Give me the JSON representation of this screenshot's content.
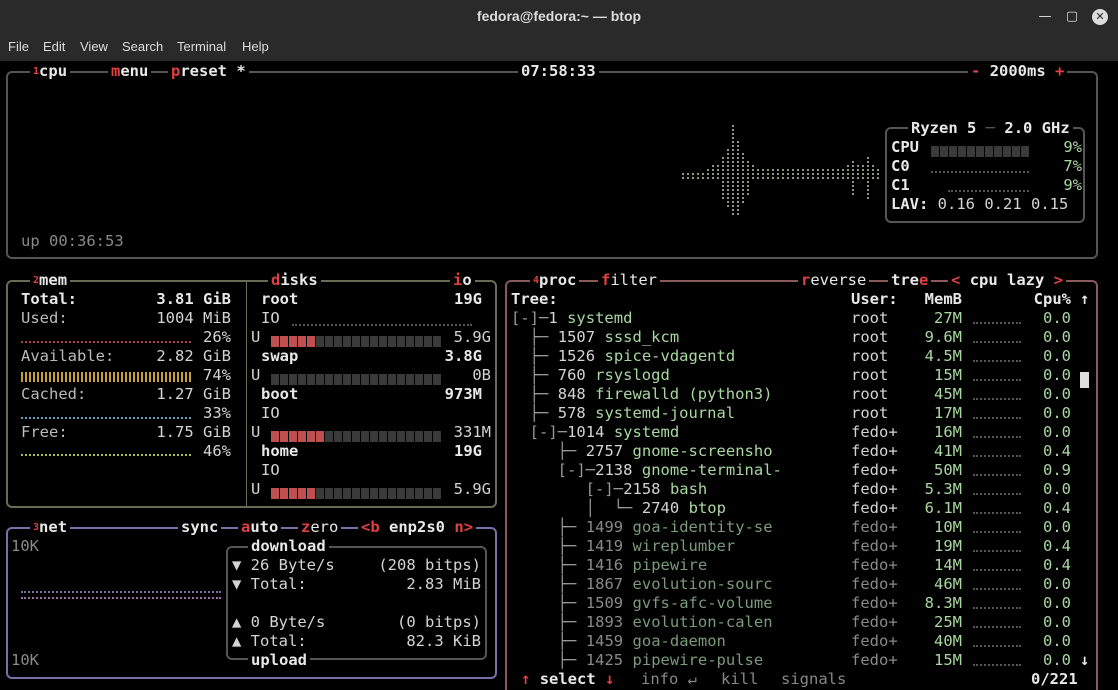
{
  "window": {
    "title": "fedora@fedora:~ — btop"
  },
  "menu": [
    "File",
    "Edit",
    "View",
    "Search",
    "Terminal",
    "Help"
  ],
  "cpu": {
    "num": "1",
    "label": "cpu",
    "menu": "menu",
    "preset": "preset *",
    "clock": "07:58:33",
    "interval": "2000ms",
    "minus": "-",
    "plus": "+",
    "uptime": "up 00:36:53",
    "model": "Ryzen 5",
    "freq": "2.0 GHz",
    "rows": [
      {
        "name": "CPU",
        "val": "9%"
      },
      {
        "name": "C0",
        "val": "7%"
      },
      {
        "name": "C1",
        "val": "9%"
      }
    ],
    "lav_label": "LAV:",
    "lav": "0.16 0.21 0.15"
  },
  "mem": {
    "num": "2",
    "label": "mem",
    "total_label": "Total:",
    "total": "3.81 GiB",
    "rows": [
      {
        "label": "Used:",
        "val": "1004 MiB",
        "pct": "26%",
        "color": "#b04040"
      },
      {
        "label": "Available:",
        "val": "2.82 GiB",
        "pct": "74%",
        "color": "#c8a030"
      },
      {
        "label": "Cached:",
        "val": "1.27 GiB",
        "pct": "33%",
        "color": "#60a0c0"
      },
      {
        "label": "Free:",
        "val": "1.75 GiB",
        "pct": "46%",
        "color": "#a0c040"
      }
    ]
  },
  "disks": {
    "label": "disks",
    "io": "io",
    "items": [
      {
        "name": "root",
        "size": "19G",
        "io": "IO",
        "u": "U",
        "used": "5.9G"
      },
      {
        "name": "swap",
        "size": "3.8G",
        "u": "U",
        "used": "0B"
      },
      {
        "name": "boot",
        "size": "973M",
        "io": "IO",
        "u": "U",
        "used": "331M"
      },
      {
        "name": "home",
        "size": "19G",
        "io": "IO",
        "u": "U",
        "used": "5.9G"
      }
    ]
  },
  "net": {
    "num": "3",
    "label": "net",
    "sync": "sync",
    "auto": "auto",
    "zero": "zero",
    "iface": "<b enp2s0 n>",
    "scale_top": "10K",
    "scale_bottom": "10K",
    "download": "download",
    "upload": "upload",
    "dl_rate": "▼ 26 Byte/s",
    "dl_bits": "(208 bitps)",
    "dl_total_label": "▼ Total:",
    "dl_total": "2.83 MiB",
    "ul_rate": "▲ 0 Byte/s",
    "ul_bits": "(0 bitps)",
    "ul_total_label": "▲ Total:",
    "ul_total": "82.3 KiB"
  },
  "proc": {
    "num": "4",
    "label": "proc",
    "filter": "filter",
    "reverse": "reverse",
    "tree": "tree",
    "lazy": "< cpu lazy >",
    "h_tree": "Tree:",
    "h_user": "User:",
    "h_mem": "MemB",
    "h_cpu": "Cpu%",
    "scroll_up": "↑",
    "scroll_down": "↓",
    "rows": [
      {
        "pre": "[-]─",
        "pid": "1",
        "name": "systemd",
        "user": "root",
        "mem": "27M",
        "cpu": "0.0",
        "dim": false
      },
      {
        "pre": "  ├─ ",
        "pid": "1507",
        "name": "sssd_kcm",
        "user": "root",
        "mem": "9.6M",
        "cpu": "0.0",
        "dim": false
      },
      {
        "pre": "  ├─ ",
        "pid": "1526",
        "name": "spice-vdagentd",
        "user": "root",
        "mem": "4.5M",
        "cpu": "0.0",
        "dim": false
      },
      {
        "pre": "  ├─ ",
        "pid": "760",
        "name": "rsyslogd",
        "user": "root",
        "mem": "15M",
        "cpu": "0.0",
        "dim": false
      },
      {
        "pre": "  ├─ ",
        "pid": "848",
        "name": "firewalld (python3)",
        "user": "root",
        "mem": "45M",
        "cpu": "0.0",
        "dim": false
      },
      {
        "pre": "  ├─ ",
        "pid": "578",
        "name": "systemd-journal",
        "user": "root",
        "mem": "17M",
        "cpu": "0.0",
        "dim": false
      },
      {
        "pre": "  [-]─",
        "pid": "1014",
        "name": "systemd",
        "user": "fedo+",
        "mem": "16M",
        "cpu": "0.0",
        "dim": false
      },
      {
        "pre": "     ├─ ",
        "pid": "2757",
        "name": "gnome-screensho",
        "user": "fedo+",
        "mem": "41M",
        "cpu": "0.4",
        "dim": false
      },
      {
        "pre": "     [-]─",
        "pid": "2138",
        "name": "gnome-terminal-",
        "user": "fedo+",
        "mem": "50M",
        "cpu": "0.9",
        "dim": false
      },
      {
        "pre": "        [-]─",
        "pid": "2158",
        "name": "bash",
        "user": "fedo+",
        "mem": "5.3M",
        "cpu": "0.0",
        "dim": false
      },
      {
        "pre": "        │  └─ ",
        "pid": "2740",
        "name": "btop",
        "user": "fedo+",
        "mem": "6.1M",
        "cpu": "0.4",
        "dim": false
      },
      {
        "pre": "     ├─ ",
        "pid": "1499",
        "name": "goa-identity-se",
        "user": "fedo+",
        "mem": "10M",
        "cpu": "0.0",
        "dim": true
      },
      {
        "pre": "     ├─ ",
        "pid": "1419",
        "name": "wireplumber",
        "user": "fedo+",
        "mem": "19M",
        "cpu": "0.4",
        "dim": true
      },
      {
        "pre": "     ├─ ",
        "pid": "1416",
        "name": "pipewire",
        "user": "fedo+",
        "mem": "14M",
        "cpu": "0.4",
        "dim": true
      },
      {
        "pre": "     ├─ ",
        "pid": "1867",
        "name": "evolution-sourc",
        "user": "fedo+",
        "mem": "46M",
        "cpu": "0.0",
        "dim": true
      },
      {
        "pre": "     ├─ ",
        "pid": "1509",
        "name": "gvfs-afc-volume",
        "user": "fedo+",
        "mem": "8.3M",
        "cpu": "0.0",
        "dim": true
      },
      {
        "pre": "     ├─ ",
        "pid": "1893",
        "name": "evolution-calen",
        "user": "fedo+",
        "mem": "25M",
        "cpu": "0.0",
        "dim": true
      },
      {
        "pre": "     ├─ ",
        "pid": "1459",
        "name": "goa-daemon",
        "user": "fedo+",
        "mem": "40M",
        "cpu": "0.0",
        "dim": true
      },
      {
        "pre": "     ├─ ",
        "pid": "1425",
        "name": "pipewire-pulse",
        "user": "fedo+",
        "mem": "15M",
        "cpu": "0.0",
        "dim": true
      }
    ],
    "footer_up": "↑",
    "select": "select",
    "down": "↓",
    "info": "info",
    "enter": "↵",
    "kill": "kill",
    "signals": "signals",
    "count": "0/221"
  },
  "colors": {
    "cpu_border": "#555555",
    "net_border": "#7b6fa8",
    "proc_border": "#8a5a5a",
    "mem_border": "#6a6a55",
    "accent": "#e04040",
    "green": "#a8d8a0"
  }
}
